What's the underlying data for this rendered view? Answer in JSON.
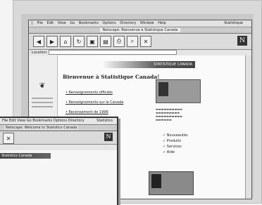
{
  "back_window": {
    "menu": [
      "File",
      "Edit",
      "View",
      "Go",
      "Bookmarks",
      "Options",
      "Directory",
      "Window",
      "Help"
    ],
    "menu_right": "Statistique",
    "title": "Netscape: Bienvenue à Statistique Canada",
    "url_label": "Location:",
    "banner": "STATISTIQUE CANADA",
    "welcome": "Bienvenue à Statistique Canada!",
    "links": [
      "Renseignements officiels",
      "Renseignements sur le Canada",
      "Recensement de 1996"
    ],
    "checks": [
      "Nouveautés",
      "Produits",
      "Services",
      "Aide"
    ],
    "logo_letter": "N"
  },
  "front_window": {
    "menu": [
      "File",
      "Edit",
      "View",
      "Go",
      "Bookmarks",
      "Options",
      "Directory"
    ],
    "menu_right": "Statistics",
    "title": "Netscape: Welcome to Statistics Canada",
    "banner": "Statistics Canada",
    "logo_letter": "N"
  }
}
